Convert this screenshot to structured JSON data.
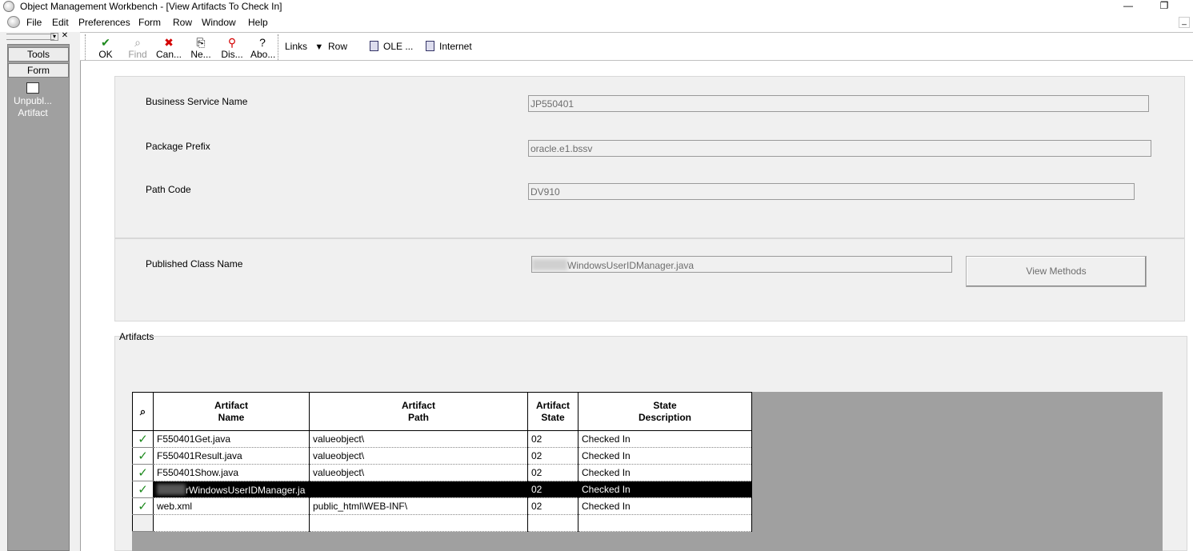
{
  "window": {
    "title": "Object Management Workbench - [View Artifacts To Check In]",
    "minimize": "—",
    "restore": "❐"
  },
  "menubar": [
    "File",
    "Edit",
    "Preferences",
    "Form",
    "Row",
    "Window",
    "Help"
  ],
  "leftpane": {
    "tools_label": "Tools",
    "form_label": "Form",
    "item_label": "Unpubl... Artifact"
  },
  "toolbar": {
    "buttons": [
      {
        "label": "OK",
        "icon": "check-icon",
        "color": "#1e8a1e",
        "glyph": "✔"
      },
      {
        "label": "Find",
        "icon": "find-icon",
        "color": "#9a9a9a",
        "glyph": "⌕"
      },
      {
        "label": "Can...",
        "icon": "cancel-icon",
        "color": "#d40000",
        "glyph": "✖"
      },
      {
        "label": "Ne...",
        "icon": "new-icon",
        "color": "#333333",
        "glyph": "⎘"
      },
      {
        "label": "Dis...",
        "icon": "display-icon",
        "color": "#d40000",
        "glyph": "⚲"
      },
      {
        "label": "Abo...",
        "icon": "about-icon",
        "color": "#333333",
        "glyph": "?"
      }
    ],
    "links_label": "Links",
    "row_label": "Row",
    "ole_label": "OLE ...",
    "internet_label": "Internet"
  },
  "form": {
    "business_service_label": "Business Service Name",
    "business_service_value": "JP550401",
    "package_prefix_label": "Package Prefix",
    "package_prefix_value": "oracle.e1.bssv",
    "path_code_label": "Path Code",
    "path_code_value": "DV910",
    "published_class_label": "Published Class Name",
    "published_class_value": "WindowsUserIDManager.java",
    "view_methods_label": "View Methods",
    "artifacts_label": "Artifacts"
  },
  "grid": {
    "columns": [
      "Artifact Name",
      "Artifact Path",
      "Artifact State",
      "State Description"
    ],
    "rows": [
      {
        "name": "F550401Get.java",
        "path": "valueobject\\",
        "state": "02",
        "desc": "Checked In"
      },
      {
        "name": "F550401Result.java",
        "path": "valueobject\\",
        "state": "02",
        "desc": "Checked In"
      },
      {
        "name": "F550401Show.java",
        "path": "valueobject\\",
        "state": "02",
        "desc": "Checked In"
      },
      {
        "name": "rWindowsUserIDManager.ja",
        "path": "",
        "state": "02",
        "desc": "Checked In"
      },
      {
        "name": "web.xml",
        "path": "public_html\\WEB-INF\\",
        "state": "02",
        "desc": "Checked In"
      }
    ]
  }
}
